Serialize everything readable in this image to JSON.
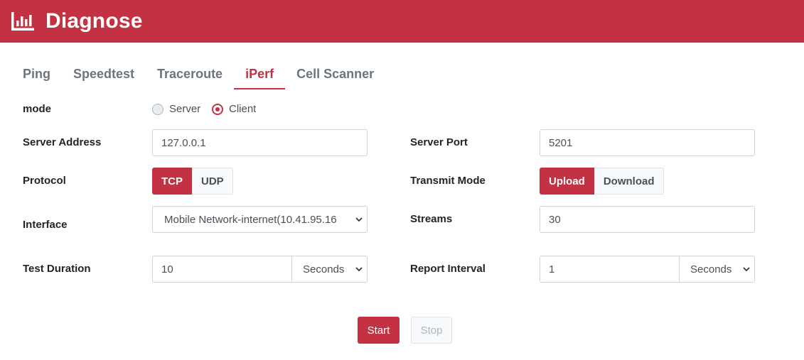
{
  "header": {
    "title": "Diagnose",
    "icon": "bar-chart-icon"
  },
  "tabs": [
    {
      "label": "Ping",
      "active": false
    },
    {
      "label": "Speedtest",
      "active": false
    },
    {
      "label": "Traceroute",
      "active": false
    },
    {
      "label": "iPerf",
      "active": true
    },
    {
      "label": "Cell Scanner",
      "active": false
    }
  ],
  "form": {
    "mode": {
      "label": "mode",
      "options": [
        "Server",
        "Client"
      ],
      "selected": "Client"
    },
    "server_address": {
      "label": "Server Address",
      "value": "127.0.0.1"
    },
    "server_port": {
      "label": "Server Port",
      "value": "5201"
    },
    "protocol": {
      "label": "Protocol",
      "options": [
        "TCP",
        "UDP"
      ],
      "selected": "TCP"
    },
    "transmit_mode": {
      "label": "Transmit Mode",
      "options": [
        "Upload",
        "Download"
      ],
      "selected": "Upload"
    },
    "interface": {
      "label": "Interface",
      "value": "Mobile Network-internet(10.41.95.16"
    },
    "streams": {
      "label": "Streams",
      "value": "30"
    },
    "test_duration": {
      "label": "Test Duration",
      "value": "10",
      "unit": "Seconds"
    },
    "report_interval": {
      "label": "Report Interval",
      "value": "1",
      "unit": "Seconds"
    }
  },
  "actions": {
    "start": "Start",
    "stop": "Stop"
  },
  "colors": {
    "brand": "#c23242",
    "muted": "#6c757d"
  }
}
